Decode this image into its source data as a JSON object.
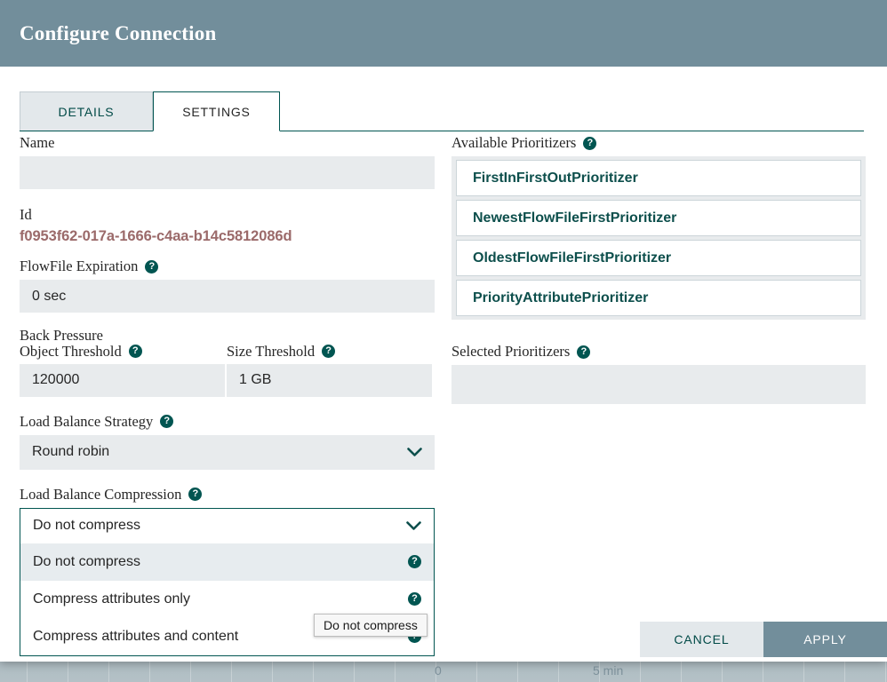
{
  "dialog": {
    "title": "Configure Connection"
  },
  "tabs": [
    {
      "label": "DETAILS",
      "active": false
    },
    {
      "label": "SETTINGS",
      "active": true
    }
  ],
  "settings": {
    "name": {
      "label": "Name",
      "value": "",
      "placeholder": ""
    },
    "id": {
      "label": "Id",
      "value": "f0953f62-017a-1666-c4aa-b14c5812086d"
    },
    "flowfile_expiration": {
      "label": "FlowFile Expiration",
      "value": "0 sec",
      "help": "?"
    },
    "back_pressure_title": "Back Pressure",
    "object_threshold": {
      "label": "Object Threshold",
      "value": "120000",
      "help": "?"
    },
    "size_threshold": {
      "label": "Size Threshold",
      "value": "1 GB",
      "help": "?"
    },
    "load_balance_strategy": {
      "label": "Load Balance Strategy",
      "value": "Round robin",
      "help": "?"
    },
    "load_balance_compression": {
      "label": "Load Balance Compression",
      "value": "Do not compress",
      "help": "?",
      "open": true,
      "options": [
        {
          "label": "Do not compress",
          "selected": true,
          "help": "?"
        },
        {
          "label": "Compress attributes only",
          "selected": false,
          "help": "?"
        },
        {
          "label": "Compress attributes and content",
          "selected": false,
          "help": "?"
        }
      ]
    }
  },
  "prioritizers": {
    "available": {
      "label": "Available Prioritizers",
      "help": "?",
      "items": [
        "FirstInFirstOutPrioritizer",
        "NewestFlowFileFirstPrioritizer",
        "OldestFlowFileFirstPrioritizer",
        "PriorityAttributePrioritizer"
      ]
    },
    "selected": {
      "label": "Selected Prioritizers",
      "help": "?",
      "items": []
    }
  },
  "tooltip": {
    "text": "Do not compress"
  },
  "footer": {
    "cancel_label": "CANCEL",
    "apply_label": "APPLY"
  },
  "background": {
    "chart_zero_label": "0",
    "chart_time_label": "5 min"
  },
  "colors": {
    "header": "#728e9b",
    "accent": "#015551",
    "input_bg": "#e8ebed",
    "id_text": "#9b6a6a",
    "apply_bg": "#728e9b"
  }
}
